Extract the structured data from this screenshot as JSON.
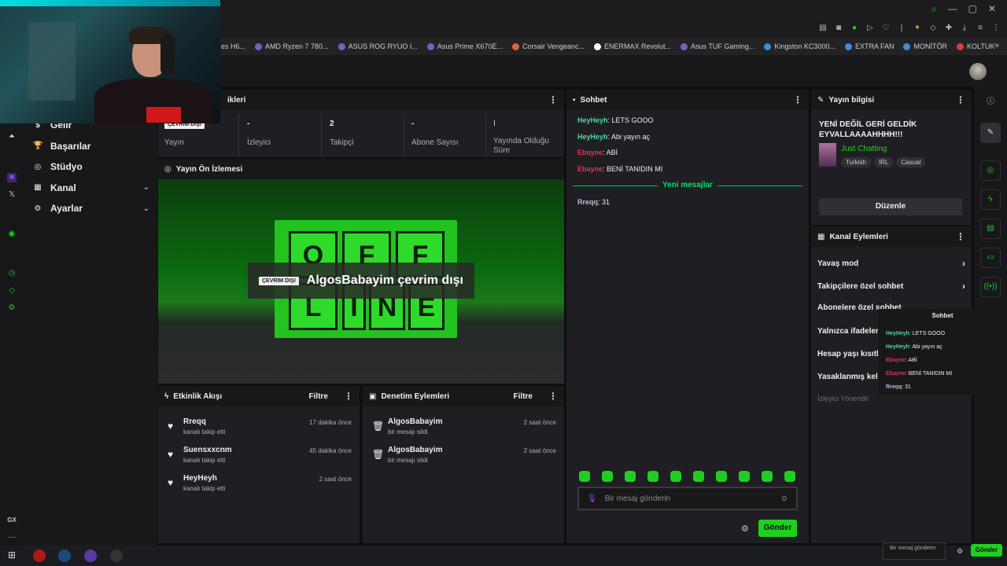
{
  "bookmarks": [
    {
      "label": "es H6...",
      "color": "#555"
    },
    {
      "label": "AMD Ryzen 7 780...",
      "color": "#7b5ec2"
    },
    {
      "label": "ASUS ROG RYUO I...",
      "color": "#7b5ec2"
    },
    {
      "label": "Asus Prime X670E...",
      "color": "#7b5ec2"
    },
    {
      "label": "Corsair Vengeanc...",
      "color": "#e0662a"
    },
    {
      "label": "ENERMAX Revolut...",
      "color": "#ffffff"
    },
    {
      "label": "Asus TUF Gaming...",
      "color": "#7b5ec2"
    },
    {
      "label": "Kingston KC3000...",
      "color": "#3b8de0"
    },
    {
      "label": "EXTRA FAN",
      "color": "#3b8de0"
    },
    {
      "label": "MONİTÖR",
      "color": "#3b8de0"
    },
    {
      "label": "KOLTUK",
      "color": "#e03b3b"
    }
  ],
  "nav": {
    "items": [
      {
        "label": "Gelir",
        "icon": "money-icon",
        "chev": ""
      },
      {
        "label": "Başarılar",
        "icon": "trophy-icon",
        "chev": ""
      },
      {
        "label": "Stüdyo",
        "icon": "studio-icon",
        "chev": ""
      },
      {
        "label": "Kanal",
        "icon": "channel-icon",
        "chev": "⌄"
      },
      {
        "label": "Ayarlar",
        "icon": "gear-icon",
        "chev": "⌄"
      }
    ]
  },
  "stats": {
    "header": "ikleri",
    "stream_badge": "ÇEVRİM DIŞI",
    "stream_label": "Yayın",
    "viewers_value": "-",
    "viewers_label": "İzleyici",
    "followers_value": "2",
    "followers_label": "Takipçi",
    "subs_value": "-",
    "subs_label": "Abone Sayısı",
    "uptime_label": "Yayında Olduğu Süre"
  },
  "preview": {
    "header": "Yayın Ön İzlemesi",
    "badge": "ÇEVRİM DIŞI",
    "title": "AlgosBabayim çevrim dışı",
    "tiles": [
      "O",
      "F",
      "F",
      "L",
      "I",
      "N",
      "E"
    ]
  },
  "activity": {
    "header": "Etkinlik Akışı",
    "filter": "Filtre",
    "items": [
      {
        "name": "Rreqq",
        "sub": "kanalı takip etti",
        "time": "17 dakika önce"
      },
      {
        "name": "Suensxxcnm",
        "sub": "kanalı takip etti",
        "time": "45 dakika önce"
      },
      {
        "name": "HeyHeyh",
        "sub": "kanalı takip etti",
        "time": "2 saat önce"
      }
    ]
  },
  "moderation": {
    "header": "Denetim Eylemleri",
    "filter": "Filtre",
    "items": [
      {
        "name": "AlgosBabayim",
        "sub": "bir mesajı sildi",
        "time": "2 saat önce"
      },
      {
        "name": "AlgosBabayim",
        "sub": "bir mesajı sildi",
        "time": "2 saat önce"
      }
    ]
  },
  "chat": {
    "header": "Sohbet",
    "messages": [
      {
        "user": "HeyHeyh",
        "text": ": LETS GOOO",
        "color": "#4fd6a0"
      },
      {
        "user": "HeyHeyh",
        "text": ": Abi yayın aç",
        "color": "#4fd6a0"
      },
      {
        "user": "Ebayne",
        "text": ": ABİ",
        "color": "#e0325a"
      },
      {
        "user": "Ebayne",
        "text": ": BENİ TANIDIN MI",
        "color": "#e0325a"
      }
    ],
    "new_messages": "Yeni mesajlar",
    "after": [
      {
        "user": "Rreqq",
        "text": ": 31",
        "color": "#c8b6d4"
      }
    ],
    "input_placeholder": "Bir mesaj gönderin",
    "send": "Gönder"
  },
  "info": {
    "header": "Yayın bilgisi",
    "title": "YENİ DEĞİL GERİ GELDİK EYVALLAAAAHHHH!!!",
    "category": "Just Chatting",
    "tags": [
      "Turkish",
      "IRL",
      "Casual"
    ],
    "edit": "Düzenle"
  },
  "actions": {
    "header": "Kanal Eylemleri",
    "items": [
      {
        "label": "Yavaş mod",
        "chev": "›"
      },
      {
        "label": "Takipçilere özel sohbet",
        "chev": "›"
      },
      {
        "label": "Abonelere özel sohbet",
        "chev": ""
      },
      {
        "label": "Yalnızca ifadeler",
        "chev": ""
      },
      {
        "label": "Hesap yaşı kısıtla",
        "chev": ""
      },
      {
        "label": "Yasaklanmış kelim",
        "chev": ""
      }
    ],
    "more": "İzleyici Yönendir"
  },
  "popout": {
    "title": "Sohbet",
    "messages": [
      {
        "user": "HeyHeyh",
        "text": ": LETS GOOO",
        "color": "#4fd6a0"
      },
      {
        "user": "HeyHeyh",
        "text": ": Abi yayın aç",
        "color": "#4fd6a0"
      },
      {
        "user": "Ebayne",
        "text": ": ABİ",
        "color": "#e0325a"
      },
      {
        "user": "Ebayne",
        "text": ": BENİ TANIDIN MI",
        "color": "#e0325a"
      },
      {
        "user": "Rreqq",
        "text": ": 31",
        "color": "#c8b6d4"
      }
    ],
    "input_placeholder": "Bir mesaj gönderin",
    "send": "Gönder"
  },
  "opera": {
    "gx_label": "GX"
  }
}
